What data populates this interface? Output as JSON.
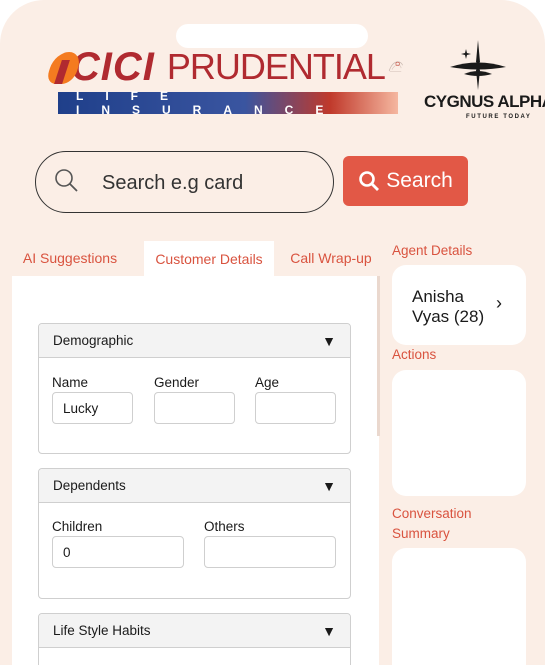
{
  "brand": {
    "icici_name": "ICICI",
    "pru_name": "PRUDENTIAL",
    "icici_sub": "LIFE INSURANCE",
    "cygnus_name": "CYGNUS ALPHA.",
    "cygnus_tag": "FUTURE TODAY"
  },
  "search": {
    "placeholder": "Search e.g card",
    "button_label": "Search",
    "icon": "search-icon"
  },
  "tabs": [
    {
      "label": "AI Suggestions",
      "active": false
    },
    {
      "label": "Customer Details",
      "active": true
    },
    {
      "label": "Call Wrap-up",
      "active": false
    }
  ],
  "sections": {
    "demographic": {
      "title": "Demographic",
      "name_label": "Name",
      "name_value": "Lucky",
      "gender_label": "Gender",
      "gender_value": "",
      "age_label": "Age",
      "age_value": ""
    },
    "dependents": {
      "title": "Dependents",
      "children_label": "Children",
      "children_value": "0",
      "others_label": "Others",
      "others_value": ""
    },
    "lifestyle": {
      "title": "Life Style Habits"
    }
  },
  "right": {
    "agent_label": "Agent Details",
    "agent_name": "Anisha Vyas (28)",
    "actions_label": "Actions",
    "summary_label": "Conversation Summary"
  },
  "colors": {
    "accent": "#d9533f",
    "button": "#e25846",
    "background": "#fbeee6"
  }
}
